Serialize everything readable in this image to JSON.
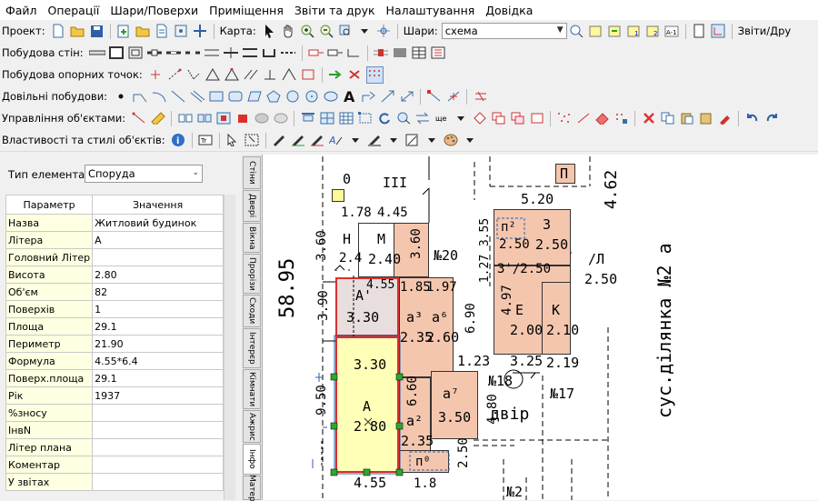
{
  "menu": [
    "Файл",
    "Операції",
    "Шари/Поверхи",
    "Приміщення",
    "Звіти та друк",
    "Налаштування",
    "Довідка"
  ],
  "toolbar_project": {
    "project_label": "Проект:",
    "map_label": "Карта:",
    "layers_label": "Шари:",
    "layer_value": "схема",
    "reports_label": "Звіти/Дру"
  },
  "toolbar_walls": {
    "label": "Побудова стін:"
  },
  "toolbar_points": {
    "label": "Побудова опорних точок:"
  },
  "toolbar_free": {
    "label": "Довільні побудови:"
  },
  "toolbar_objects": {
    "label": "Управління об'єктами:"
  },
  "toolbar_styles": {
    "label": "Властивості та стилі об'єктів:"
  },
  "left_panel": {
    "element_type_label": "Тип елемента:",
    "element_type_value": "Споруда",
    "col_param": "Параметр",
    "col_value": "Значення",
    "rows": [
      {
        "name": "Назва",
        "value": "Житловий будинок"
      },
      {
        "name": "Літера",
        "value": "А"
      },
      {
        "name": "Головний Літер",
        "value": ""
      },
      {
        "name": "Висота",
        "value": "2.80"
      },
      {
        "name": "Об'єм",
        "value": "82"
      },
      {
        "name": "Поверхів",
        "value": "1"
      },
      {
        "name": "Площа",
        "value": "29.1"
      },
      {
        "name": "Периметр",
        "value": "21.90"
      },
      {
        "name": "Формула",
        "value": "4.55*6.4"
      },
      {
        "name": "Поверх.площа",
        "value": "29.1"
      },
      {
        "name": "Рік",
        "value": "1937"
      },
      {
        "name": "%зносу",
        "value": ""
      },
      {
        "name": "ІнвN",
        "value": ""
      },
      {
        "name": "Літер плана",
        "value": ""
      },
      {
        "name": "Коментар",
        "value": ""
      },
      {
        "name": "У звітах",
        "value": ""
      }
    ]
  },
  "side_tabs": [
    "Стіни",
    "Двері",
    "Вікна",
    "Прорізи",
    "Сходи",
    "Інтерєр",
    "Кімнати",
    "Ажрис",
    "Інфо",
    "Матер"
  ],
  "canvas": {
    "dims": [
      "0",
      "III",
      "1.78",
      "4.45",
      "Н",
      "2.4",
      "М",
      "2.40",
      "3.60",
      "3.60",
      "№20",
      "3.55",
      "1.27",
      "5.20",
      "3",
      "2.50",
      "п²",
      "2.50",
      "3'/2.50",
      "П",
      "4.62",
      "/Л",
      "2.50",
      "А'",
      "4.55",
      "3.30",
      "1.85",
      "1.97",
      "а³",
      "а⁶",
      "2.35",
      "2.60",
      "4.97",
      "Е",
      "2.00",
      "К",
      "2.10",
      "58.95",
      "3.90",
      "6.90",
      "1.23",
      "3.25",
      "2.19",
      "3.30",
      "№18",
      "№17",
      "А",
      "2.80",
      "9.50",
      "6.60",
      "а²",
      "2.35",
      "а⁷",
      "3.50",
      "4.80",
      "двір",
      "2.50",
      "п⁰",
      "4.55",
      "1.8",
      "№2",
      "сус.ділянка №2 а"
    ]
  }
}
